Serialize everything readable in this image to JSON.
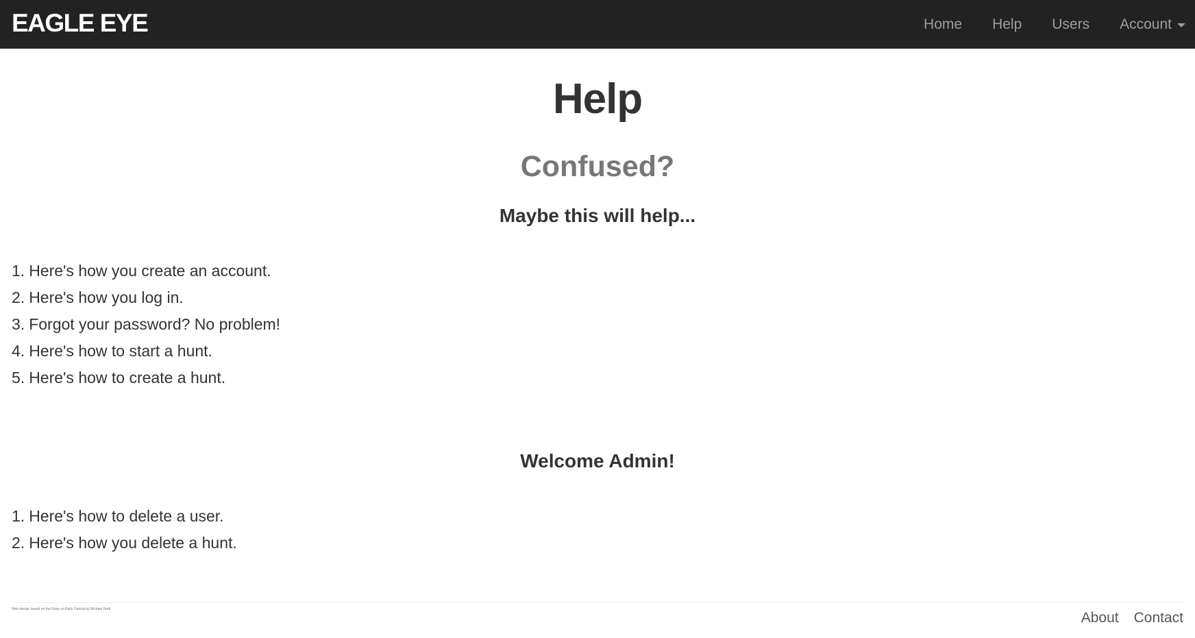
{
  "navbar": {
    "brand": "EAGLE EYE",
    "links": [
      {
        "label": "Home"
      },
      {
        "label": "Help"
      },
      {
        "label": "Users"
      },
      {
        "label": "Account",
        "dropdown": true
      }
    ]
  },
  "main": {
    "title": "Help",
    "subtitle": "Confused?",
    "help_heading": "Maybe this will help...",
    "user_steps": [
      {
        "number": "1.",
        "text": "Here's how you create an account."
      },
      {
        "number": "2.",
        "text": "Here's how you log in."
      },
      {
        "number": "3.",
        "text": "Forgot your password? No problem!"
      },
      {
        "number": "4.",
        "text": "Here's how to start a hunt."
      },
      {
        "number": "5.",
        "text": "Here's how to create a hunt."
      }
    ],
    "admin_heading": "Welcome Admin!",
    "admin_steps": [
      {
        "number": "1.",
        "text": "Here's how to delete a user."
      },
      {
        "number": "2.",
        "text": "Here's how you delete a hunt."
      }
    ]
  },
  "footer": {
    "credit": "Web design based on the Ruby on Rails Tutorial by Michael Hartl",
    "links": [
      {
        "label": "About"
      },
      {
        "label": "Contact"
      }
    ]
  },
  "colors": {
    "navbar_bg": "#222222",
    "brand": "#ffffff",
    "nav_link": "#9d9d9d",
    "text": "#333333",
    "muted": "#777777"
  },
  "icons": {
    "account_dropdown": "caret-down-icon"
  }
}
